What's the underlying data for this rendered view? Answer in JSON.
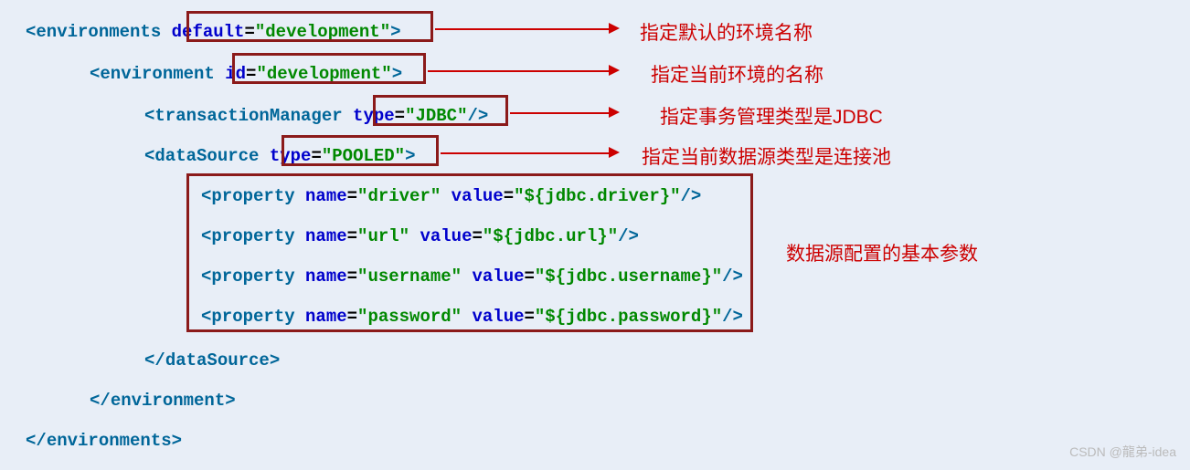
{
  "code": {
    "l1": {
      "tag": "environments",
      "attr": "default",
      "val": "\"development\""
    },
    "l2": {
      "tag": "environment",
      "attr": "id",
      "val": "\"development\""
    },
    "l3": {
      "tag": "transactionManager",
      "attr": "type",
      "val": "\"JDBC\""
    },
    "l4": {
      "tag": "dataSource",
      "attr": "type",
      "val": "\"POOLED\""
    },
    "props": [
      {
        "tag": "property",
        "a1": "name",
        "v1": "\"driver\"",
        "a2": "value",
        "v2": "\"${jdbc.driver}\""
      },
      {
        "tag": "property",
        "a1": "name",
        "v1": "\"url\"",
        "a2": "value",
        "v2": "\"${jdbc.url}\""
      },
      {
        "tag": "property",
        "a1": "name",
        "v1": "\"username\"",
        "a2": "value",
        "v2": "\"${jdbc.username}\""
      },
      {
        "tag": "property",
        "a1": "name",
        "v1": "\"password\"",
        "a2": "value",
        "v2": "\"${jdbc.password}\""
      }
    ],
    "close_ds": "dataSource",
    "close_env": "environment",
    "close_envs": "environments"
  },
  "annotations": {
    "a1": "指定默认的环境名称",
    "a2": "指定当前环境的名称",
    "a3": "指定事务管理类型是JDBC",
    "a4": "指定当前数据源类型是连接池",
    "a5": "数据源配置的基本参数"
  },
  "watermark": "CSDN @龍弟-idea"
}
